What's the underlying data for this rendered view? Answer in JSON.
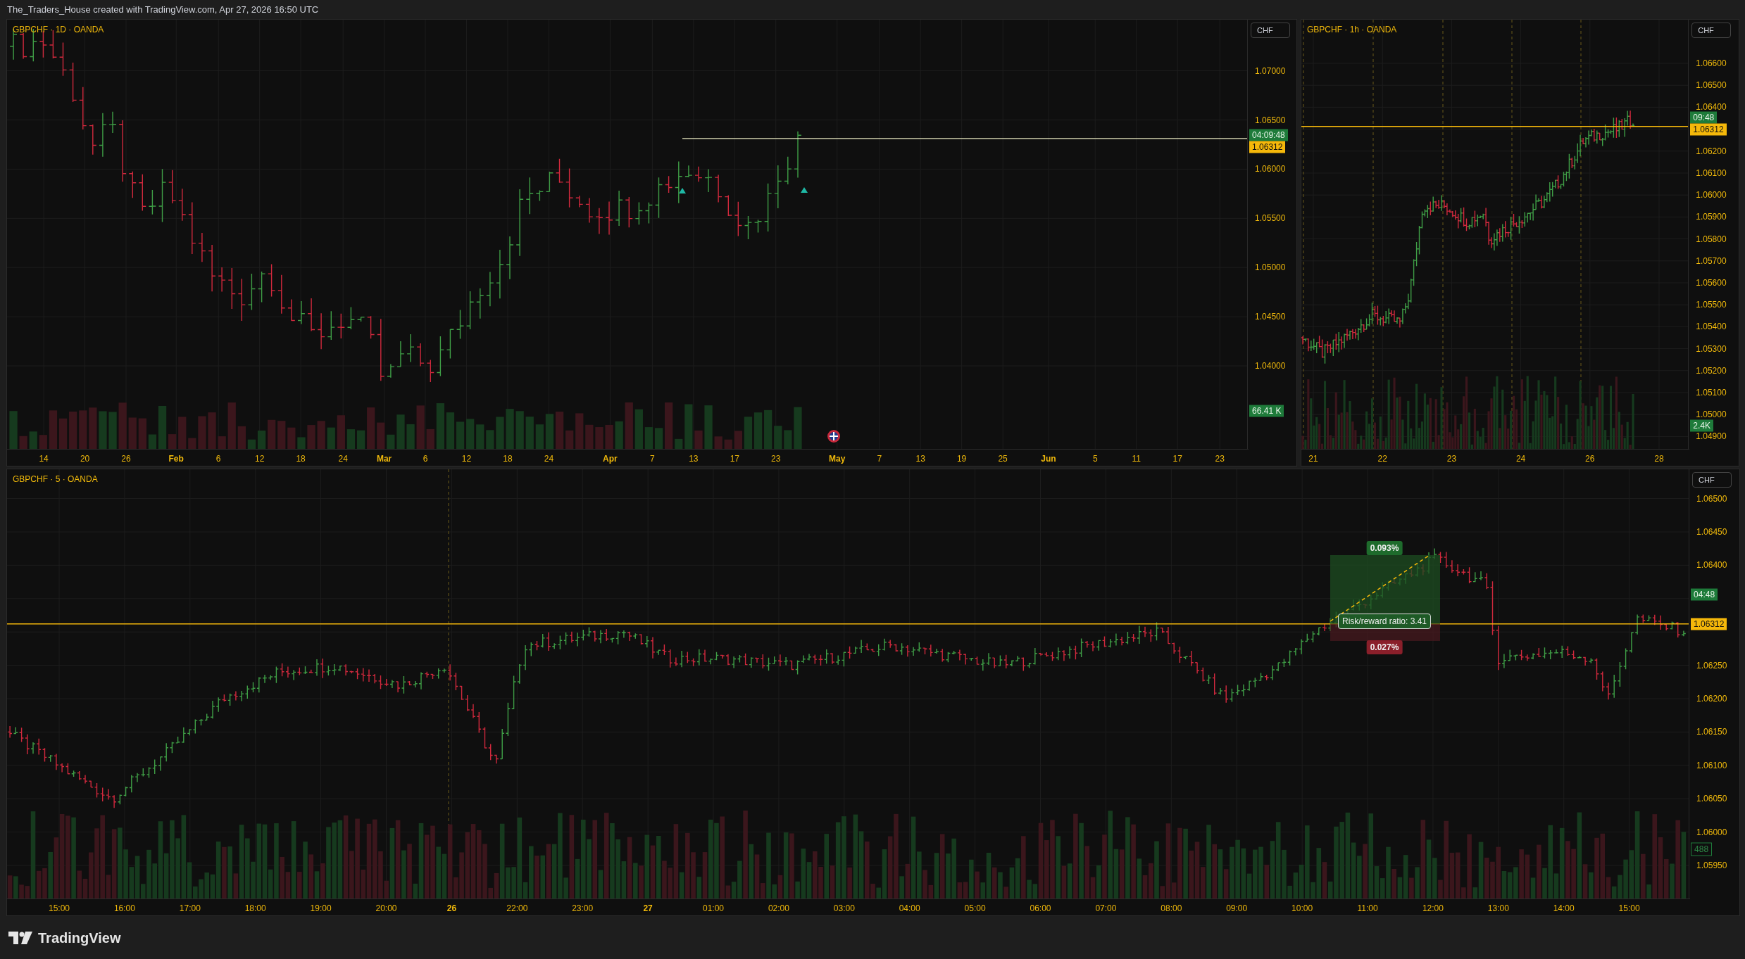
{
  "header": {
    "title": "The_Traders_House created with TradingView.com, Apr 27, 2026 16:50 UTC"
  },
  "panes": [
    {
      "legend": "GBPCHF · 1D · OANDA",
      "currency": "CHF",
      "price_axis": [
        "1.07000",
        "1.06500",
        "1.06000",
        "1.05500",
        "1.05000",
        "1.04500",
        "1.04000"
      ],
      "badges": [
        {
          "kind": "countdown",
          "text": "04:09:48"
        },
        {
          "kind": "price",
          "text": "1.06312"
        },
        {
          "kind": "volume",
          "text": "66.41 K"
        }
      ],
      "time_axis": [
        {
          "label": "14",
          "kind": "day"
        },
        {
          "label": "20",
          "kind": "day"
        },
        {
          "label": "26",
          "kind": "day"
        },
        {
          "label": "Feb",
          "kind": "period"
        },
        {
          "label": "6",
          "kind": "day"
        },
        {
          "label": "12",
          "kind": "day"
        },
        {
          "label": "18",
          "kind": "day"
        },
        {
          "label": "24",
          "kind": "day"
        },
        {
          "label": "Mar",
          "kind": "period"
        },
        {
          "label": "6",
          "kind": "day"
        },
        {
          "label": "12",
          "kind": "day"
        },
        {
          "label": "18",
          "kind": "day"
        },
        {
          "label": "24",
          "kind": "day"
        },
        {
          "label": "Apr",
          "kind": "period"
        },
        {
          "label": "7",
          "kind": "day"
        },
        {
          "label": "13",
          "kind": "day"
        },
        {
          "label": "17",
          "kind": "day"
        },
        {
          "label": "23",
          "kind": "day"
        },
        {
          "label": "May",
          "kind": "period"
        },
        {
          "label": "7",
          "kind": "day"
        },
        {
          "label": "13",
          "kind": "day"
        },
        {
          "label": "19",
          "kind": "day"
        },
        {
          "label": "25",
          "kind": "day"
        },
        {
          "label": "Jun",
          "kind": "period"
        },
        {
          "label": "5",
          "kind": "day"
        },
        {
          "label": "11",
          "kind": "day"
        },
        {
          "label": "17",
          "kind": "day"
        },
        {
          "label": "23",
          "kind": "day"
        }
      ]
    },
    {
      "legend": "GBPCHF · 1h · OANDA",
      "currency": "CHF",
      "price_axis": [
        "1.06600",
        "1.06500",
        "1.06400",
        "1.06200",
        "1.06100",
        "1.06000",
        "1.05900",
        "1.05800",
        "1.05700",
        "1.05600",
        "1.05500",
        "1.05400",
        "1.05300",
        "1.05200",
        "1.05100",
        "1.05000",
        "1.04900"
      ],
      "badges": [
        {
          "kind": "countdown",
          "text": "09:48"
        },
        {
          "kind": "price",
          "text": "1.06312"
        },
        {
          "kind": "volume",
          "text": "2.4K"
        }
      ],
      "time_axis": [
        {
          "label": "21",
          "kind": "day"
        },
        {
          "label": "22",
          "kind": "day"
        },
        {
          "label": "23",
          "kind": "day"
        },
        {
          "label": "24",
          "kind": "day"
        },
        {
          "label": "26",
          "kind": "day"
        },
        {
          "label": "28",
          "kind": "day"
        }
      ]
    },
    {
      "legend": "GBPCHF · 5 · OANDA",
      "currency": "CHF",
      "price_axis": [
        "1.06500",
        "1.06450",
        "1.06400",
        "1.06250",
        "1.06200",
        "1.06150",
        "1.06100",
        "1.06050",
        "1.06000",
        "1.05950"
      ],
      "badges": [
        {
          "kind": "countdown",
          "text": "04:48"
        },
        {
          "kind": "price",
          "text": "1.06312"
        },
        {
          "kind": "volume_outline",
          "text": "488"
        }
      ],
      "time_axis": [
        {
          "label": "15:00",
          "kind": "day"
        },
        {
          "label": "16:00",
          "kind": "day"
        },
        {
          "label": "17:00",
          "kind": "day"
        },
        {
          "label": "18:00",
          "kind": "day"
        },
        {
          "label": "19:00",
          "kind": "day"
        },
        {
          "label": "20:00",
          "kind": "day"
        },
        {
          "label": "26",
          "kind": "period"
        },
        {
          "label": "22:00",
          "kind": "day"
        },
        {
          "label": "23:00",
          "kind": "day"
        },
        {
          "label": "27",
          "kind": "period"
        },
        {
          "label": "01:00",
          "kind": "day"
        },
        {
          "label": "02:00",
          "kind": "day"
        },
        {
          "label": "03:00",
          "kind": "day"
        },
        {
          "label": "04:00",
          "kind": "day"
        },
        {
          "label": "05:00",
          "kind": "day"
        },
        {
          "label": "06:00",
          "kind": "day"
        },
        {
          "label": "07:00",
          "kind": "day"
        },
        {
          "label": "08:00",
          "kind": "day"
        },
        {
          "label": "09:00",
          "kind": "day"
        },
        {
          "label": "10:00",
          "kind": "day"
        },
        {
          "label": "11:00",
          "kind": "day"
        },
        {
          "label": "12:00",
          "kind": "day"
        },
        {
          "label": "13:00",
          "kind": "day"
        },
        {
          "label": "14:00",
          "kind": "day"
        },
        {
          "label": "15:00",
          "kind": "day"
        }
      ],
      "position_tool": {
        "target": "0.093%",
        "ratio": "Risk/reward ratio: 3.41",
        "stop": "0.027%"
      }
    }
  ],
  "footer": {
    "logo": "TradingView"
  }
}
